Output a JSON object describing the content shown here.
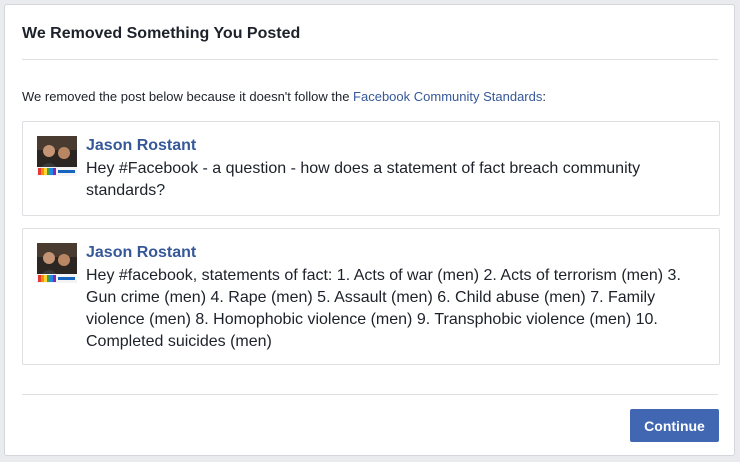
{
  "dialog": {
    "title": "We Removed Something You Posted",
    "intro_prefix": "We removed the post below because it doesn't follow the ",
    "intro_link": "Facebook Community Standards",
    "intro_suffix": ":",
    "continue_label": "Continue"
  },
  "posts": [
    {
      "author": "Jason Rostant",
      "text": "Hey #Facebook - a question - how does a statement of fact breach community standards?"
    },
    {
      "author": "Jason Rostant",
      "text": "Hey #facebook, statements of fact: 1. Acts of war (men) 2. Acts of terrorism (men) 3. Gun crime (men) 4. Rape (men) 5. Assault (men) 6. Child abuse (men) 7. Family violence (men) 8. Homophobic violence (men) 9. Transphobic violence (men) 10. Completed suicides (men)"
    }
  ],
  "colors": {
    "link": "#365899",
    "button": "#4267b2"
  }
}
